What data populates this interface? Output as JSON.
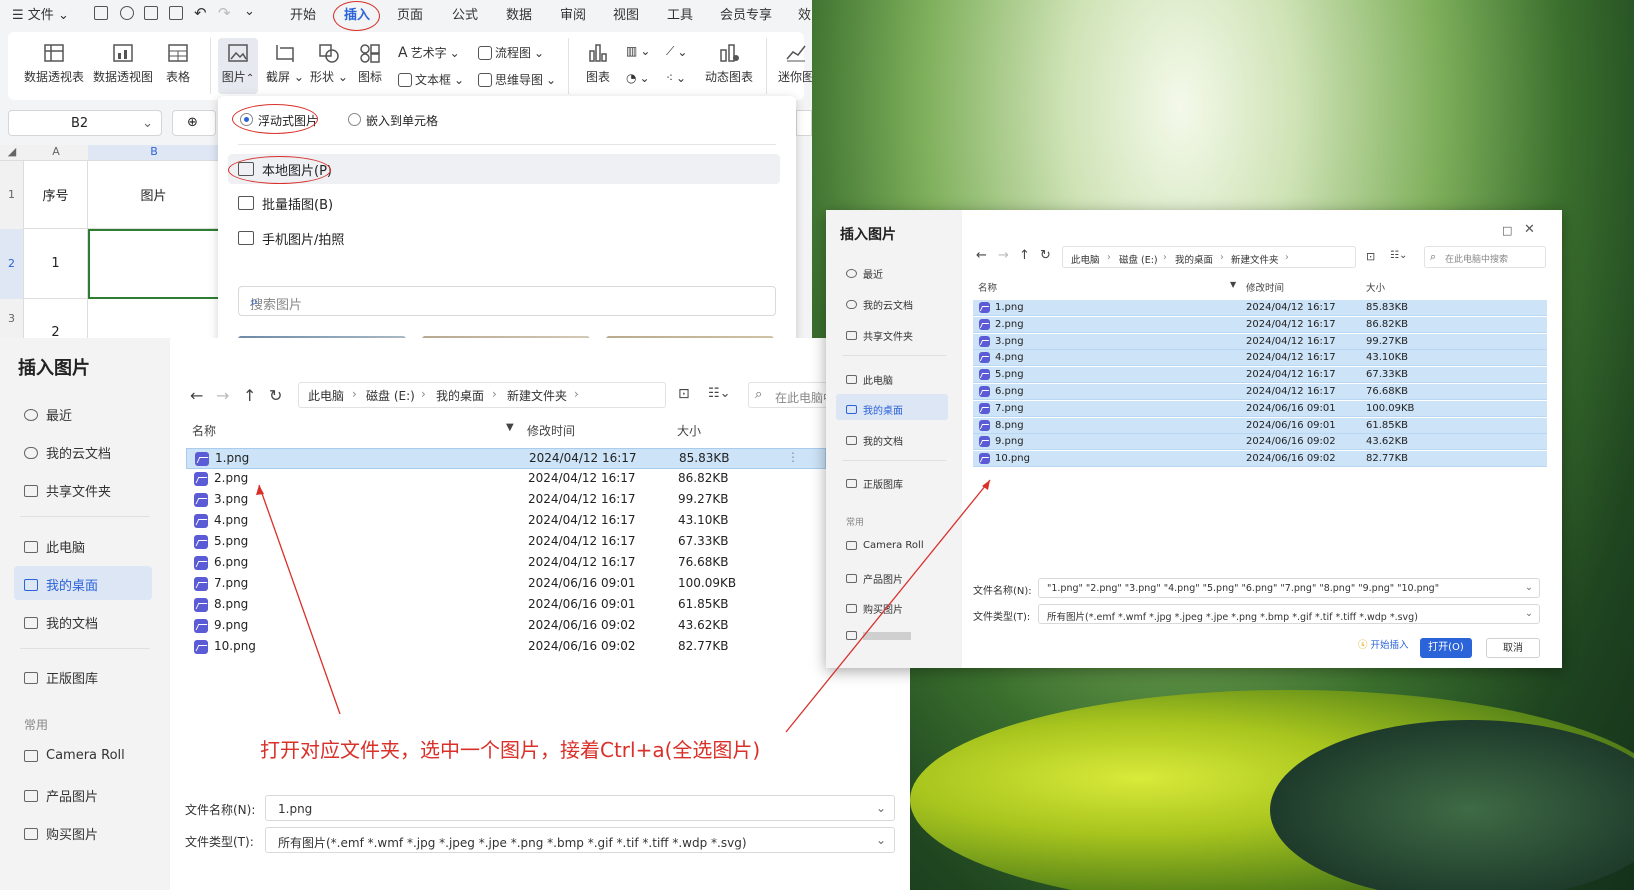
{
  "wps": {
    "menu": [
      "文件",
      "开始",
      "插入",
      "页面",
      "公式",
      "数据",
      "审阅",
      "视图",
      "工具",
      "会员专享",
      "效"
    ],
    "ribbon_big": [
      "数据透视表",
      "数据透视图",
      "表格",
      "图片",
      "截屏",
      "形状",
      "图标",
      "图表",
      "动态图表",
      "迷你图"
    ],
    "ribbon_small": [
      "艺术字",
      "文本框",
      "流程图",
      "思维导图"
    ],
    "name_box": "B2",
    "columns": [
      "A",
      "B"
    ],
    "rows": [
      "1",
      "2",
      "3"
    ],
    "cells": {
      "a1": "序号",
      "b1": "图片",
      "a2": "1",
      "a3": "2"
    },
    "picture_menu": {
      "option_floating": "浮动式图片",
      "option_embed": "嵌入到单元格",
      "item_local": "本地图片(P)",
      "item_batch": "批量插图(B)",
      "item_phone": "手机图片/拍照",
      "search_placeholder": "搜索图片"
    }
  },
  "dialog_large": {
    "title": "插入图片",
    "nav": [
      "最近",
      "我的云文档",
      "共享文件夹",
      "此电脑",
      "我的桌面",
      "我的文档",
      "正版图库",
      "常用",
      "Camera Roll",
      "产品图片",
      "购买图片"
    ],
    "breadcrumb": [
      "此电脑",
      "磁盘 (E:)",
      "我的桌面",
      "新建文件夹"
    ],
    "search_placeholder": "在此电脑中",
    "columns": {
      "name": "名称",
      "modified": "修改时间",
      "size": "大小"
    },
    "filename_label": "文件名称(N):",
    "filename_value": "1.png",
    "filetype_label": "文件类型(T):",
    "filetype_value": "所有图片(*.emf *.wmf *.jpg *.jpeg *.jpe *.png *.bmp *.gif *.tif *.tiff *.wdp *.svg)"
  },
  "files": [
    {
      "name": "1.png",
      "date": "2024/04/12 16:17",
      "size": "85.83KB"
    },
    {
      "name": "2.png",
      "date": "2024/04/12 16:17",
      "size": "86.82KB"
    },
    {
      "name": "3.png",
      "date": "2024/04/12 16:17",
      "size": "99.27KB"
    },
    {
      "name": "4.png",
      "date": "2024/04/12 16:17",
      "size": "43.10KB"
    },
    {
      "name": "5.png",
      "date": "2024/04/12 16:17",
      "size": "67.33KB"
    },
    {
      "name": "6.png",
      "date": "2024/04/12 16:17",
      "size": "76.68KB"
    },
    {
      "name": "7.png",
      "date": "2024/06/16 09:01",
      "size": "100.09KB"
    },
    {
      "name": "8.png",
      "date": "2024/06/16 09:01",
      "size": "61.85KB"
    },
    {
      "name": "9.png",
      "date": "2024/06/16 09:02",
      "size": "43.62KB"
    },
    {
      "name": "10.png",
      "date": "2024/06/16 09:02",
      "size": "82.77KB"
    }
  ],
  "caption": "打开对应文件夹，选中一个图片，接着Ctrl+a(全选图片)",
  "dialog_small": {
    "title": "插入图片",
    "nav": [
      "最近",
      "我的云文档",
      "共享文件夹",
      "此电脑",
      "我的桌面",
      "我的文档",
      "正版图库",
      "常用",
      "Camera Roll",
      "产品图片",
      "购买图片"
    ],
    "breadcrumb": [
      "此电脑",
      "磁盘 (E:)",
      "我的桌面",
      "新建文件夹"
    ],
    "search_placeholder": "在此电脑中搜索",
    "columns": {
      "name": "名称",
      "modified": "修改时间",
      "size": "大小"
    },
    "filename_label": "文件名称(N):",
    "filename_value": "\"1.png\" \"2.png\" \"3.png\" \"4.png\" \"5.png\" \"6.png\" \"7.png\" \"8.png\" \"9.png\" \"10.png\"",
    "filetype_label": "文件类型(T):",
    "filetype_value": "所有图片(*.emf *.wmf *.jpg *.jpeg *.jpe *.png *.bmp *.gif *.tif *.tiff *.wdp *.svg)",
    "start_insert": "开始插入",
    "open_button": "打开(O)",
    "cancel_button": "取消"
  },
  "colors": {
    "accent": "#2b63d9",
    "annotation": "#d9302a",
    "selection": "#cde3f7",
    "file_icon": "#5b5bd6"
  }
}
